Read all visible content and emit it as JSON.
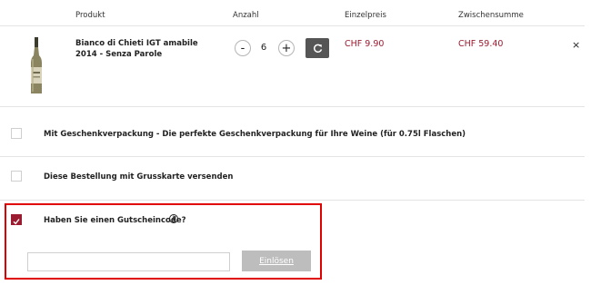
{
  "columns": {
    "produkt": "Produkt",
    "anzahl": "Anzahl",
    "einzelpreis": "Einzelpreis",
    "zwischensumme": "Zwischensumme"
  },
  "cart_item": {
    "name": "Bianco di Chieti IGT amabile 2014 - Senza Parole",
    "quantity": "6",
    "decrease_label": "-",
    "increase_label": "+",
    "unit_price": "CHF 9.90",
    "subtotal": "CHF 59.40",
    "remove_label": "×",
    "image_icon": "wine-bottle-icon"
  },
  "options": {
    "gift_wrap": "Mit Geschenkverpackung - Die perfekte Geschenkverpackung für Ihre Weine (für 0.75l Flaschen)",
    "greeting_card": "Diese Bestellung mit Grusskarte versenden",
    "voucher": "Haben Sie einen Gutscheincode?"
  },
  "voucher_form": {
    "input_value": "",
    "input_placeholder": "",
    "redeem_label": "Einlösen"
  },
  "icons": {
    "refresh": "refresh-icon",
    "info": "info-icon",
    "check": "checkmark-icon"
  },
  "colors": {
    "accent": "#9b1c30",
    "refresh_button": "#555555",
    "redeem_button": "#bdbdbd",
    "highlight": "#e00000"
  }
}
